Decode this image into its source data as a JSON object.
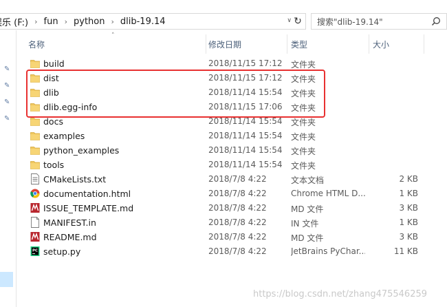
{
  "breadcrumb": {
    "items": [
      "娱乐 (F:)",
      "fun",
      "python",
      "dlib-19.14"
    ]
  },
  "search": {
    "placeholder": "搜索\"dlib-19.14\""
  },
  "columns": {
    "name": "名称",
    "date": "修改日期",
    "type": "类型",
    "size": "大小"
  },
  "files": [
    {
      "name": "build",
      "date": "2018/11/15 17:12",
      "type": "文件夹",
      "size": "",
      "icon": "folder-icon"
    },
    {
      "name": "dist",
      "date": "2018/11/15 17:12",
      "type": "文件夹",
      "size": "",
      "icon": "folder-icon"
    },
    {
      "name": "dlib",
      "date": "2018/11/14 15:54",
      "type": "文件夹",
      "size": "",
      "icon": "folder-icon"
    },
    {
      "name": "dlib.egg-info",
      "date": "2018/11/15 17:06",
      "type": "文件夹",
      "size": "",
      "icon": "folder-icon"
    },
    {
      "name": "docs",
      "date": "2018/11/14 15:54",
      "type": "文件夹",
      "size": "",
      "icon": "folder-icon"
    },
    {
      "name": "examples",
      "date": "2018/11/14 15:54",
      "type": "文件夹",
      "size": "",
      "icon": "folder-icon"
    },
    {
      "name": "python_examples",
      "date": "2018/11/14 15:54",
      "type": "文件夹",
      "size": "",
      "icon": "folder-icon"
    },
    {
      "name": "tools",
      "date": "2018/11/14 15:54",
      "type": "文件夹",
      "size": "",
      "icon": "folder-icon"
    },
    {
      "name": "CMakeLists.txt",
      "date": "2018/7/8 4:22",
      "type": "文本文档",
      "size": "2 KB",
      "icon": "text-file-icon"
    },
    {
      "name": "documentation.html",
      "date": "2018/7/8 4:22",
      "type": "Chrome HTML D...",
      "size": "1 KB",
      "icon": "chrome-icon"
    },
    {
      "name": "ISSUE_TEMPLATE.md",
      "date": "2018/7/8 4:22",
      "type": "MD 文件",
      "size": "3 KB",
      "icon": "markdown-file-icon"
    },
    {
      "name": "MANIFEST.in",
      "date": "2018/7/8 4:22",
      "type": "IN 文件",
      "size": "1 KB",
      "icon": "blank-file-icon"
    },
    {
      "name": "README.md",
      "date": "2018/7/8 4:22",
      "type": "MD 文件",
      "size": "3 KB",
      "icon": "markdown-file-icon"
    },
    {
      "name": "setup.py",
      "date": "2018/7/8 4:22",
      "type": "JetBrains PyChar...",
      "size": "11 KB",
      "icon": "pycharm-file-icon"
    }
  ],
  "watermark": "https://blog.csdn.net/zhang475546259",
  "colors": {
    "highlight": "#e83030",
    "folder": "#f0c75e",
    "header_text": "#4c607a"
  }
}
